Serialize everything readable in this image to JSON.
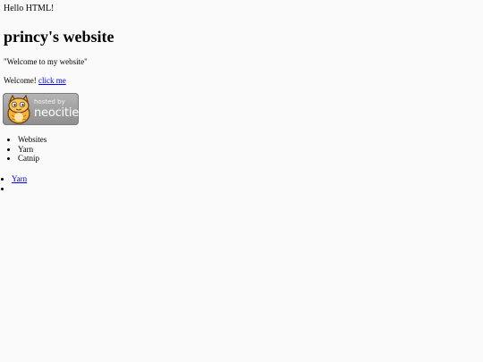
{
  "page": {
    "hello": "Hello HTML!",
    "title": "princy's website",
    "quote": "\"Welcome to my website\"",
    "welcome_text": "Welcome!",
    "welcome_link": "click me"
  },
  "badge": {
    "hosted_by": "hosted by",
    "brand": "neocities",
    "icon": "cat-icon"
  },
  "menu": {
    "items": [
      "Websites",
      "Yarn",
      "Catnip"
    ]
  },
  "links": {
    "items": [
      "Yarn",
      ""
    ]
  },
  "colors": {
    "background": "#fafafa",
    "link": "#0000ee",
    "badge": "#a0a0a0"
  }
}
